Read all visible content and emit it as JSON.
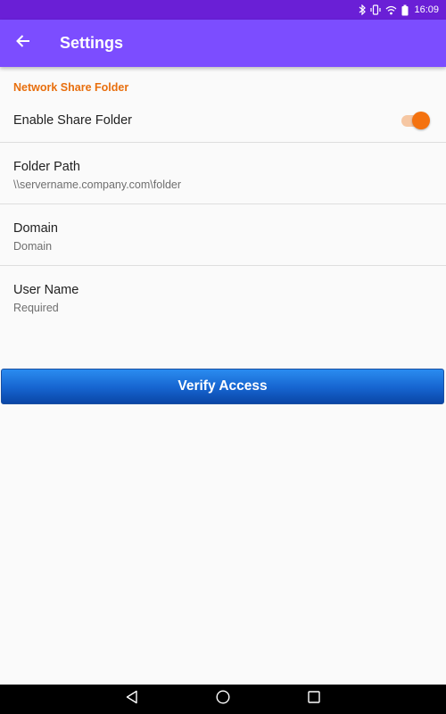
{
  "status_bar": {
    "time": "16:09",
    "icons": [
      "bluetooth-icon",
      "vibrate-icon",
      "wifi-icon",
      "battery-icon"
    ],
    "background": "#6a1fd6"
  },
  "app_bar": {
    "title": "Settings",
    "back_icon": "arrow-back-icon",
    "background": "#7c4dff"
  },
  "section": {
    "header": "Network Share Folder",
    "header_color": "#e86f0e"
  },
  "enable_share_folder": {
    "label": "Enable Share Folder",
    "enabled": true,
    "accent": "#f4720f"
  },
  "preferences": [
    {
      "title": "Folder Path",
      "summary": "\\\\servername.company.com\\folder"
    },
    {
      "title": "Domain",
      "summary": "Domain"
    },
    {
      "title": "User Name",
      "summary": "Required"
    }
  ],
  "verify_button": {
    "label": "Verify Access",
    "color": "#1664cf"
  },
  "nav_bar": {
    "buttons": [
      "back-triangle-icon",
      "home-circle-icon",
      "recents-square-icon"
    ]
  }
}
